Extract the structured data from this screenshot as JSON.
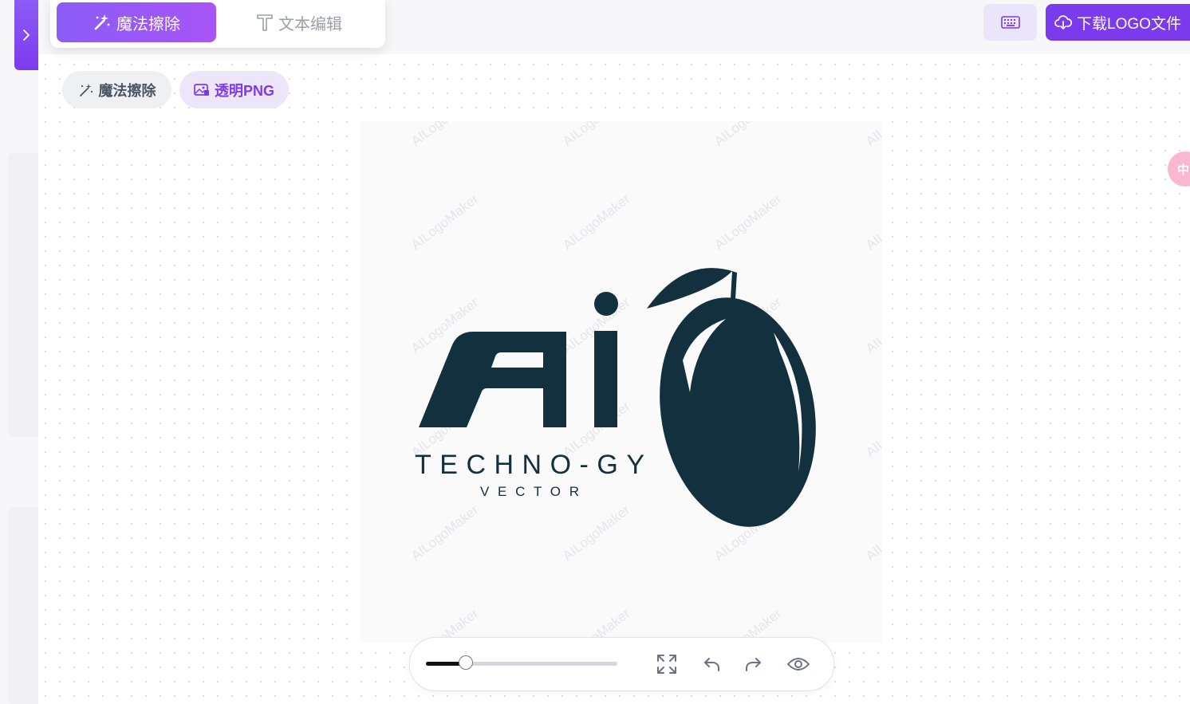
{
  "mode_tabs": {
    "active_label": "魔法擦除",
    "inactive_label": "文本编辑"
  },
  "header": {
    "keyboard_icon": "keyboard-icon",
    "download_label": "下载LOGO文件",
    "download_icon": "cloud-download-icon"
  },
  "tools": {
    "magic_erase_label": "魔法擦除",
    "transparent_png_label": "透明PNG"
  },
  "canvas": {
    "watermark": "AILogoMaker",
    "logo": {
      "mark_text": "Ai",
      "main_text": "TECHNO-GY",
      "sub_text": "VECTOR",
      "color": "#12303d",
      "icon": "mango-leaf-icon"
    }
  },
  "bottom_bar": {
    "zoom_fraction": 0.21,
    "icons": [
      "fullscreen-icon",
      "undo-icon",
      "redo-icon",
      "eye-icon"
    ]
  },
  "side_bubble": {
    "label": "中"
  },
  "colors": {
    "accent": "#7c3aed",
    "accent_light": "#ede6fb",
    "tab_gradient_start": "#8b5cf6",
    "tab_gradient_end": "#a855f7"
  }
}
